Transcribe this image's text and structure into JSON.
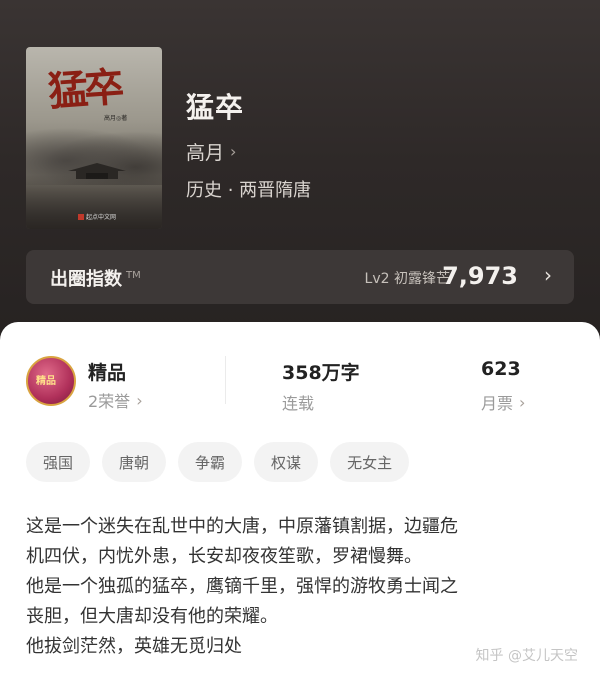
{
  "book": {
    "cover_title": "猛卒",
    "cover_author": "高月◎著",
    "cover_publisher": "起点中文网",
    "title": "猛卒",
    "author": "高月",
    "genre": "历史 · 两晋隋唐"
  },
  "index": {
    "label": "出圈指数",
    "tm": "TM",
    "level": "Lv2 初露锋芒",
    "value": "7,973"
  },
  "stats": {
    "badge_text": "精品",
    "quality": "精品",
    "honors": "2荣誉",
    "words": "358万字",
    "status": "连载",
    "tickets": "623",
    "tickets_label": "月票"
  },
  "tags": [
    "强国",
    "唐朝",
    "争霸",
    "权谋",
    "无女主"
  ],
  "description": [
    "这是一个迷失在乱世中的大唐，中原藩镇割据，边疆危",
    "机四伏，内忧外患，长安却夜夜笙歌，罗裙慢舞。",
    "他是一个独孤的猛卒，鹰镝千里，强悍的游牧勇士闻之",
    "丧胆，但大唐却没有他的荣耀。",
    "他拔剑茫然，英雄无觅归处"
  ],
  "watermark": "知乎 @艾儿天空",
  "icons": {
    "chevron": "chevron-right-icon"
  }
}
